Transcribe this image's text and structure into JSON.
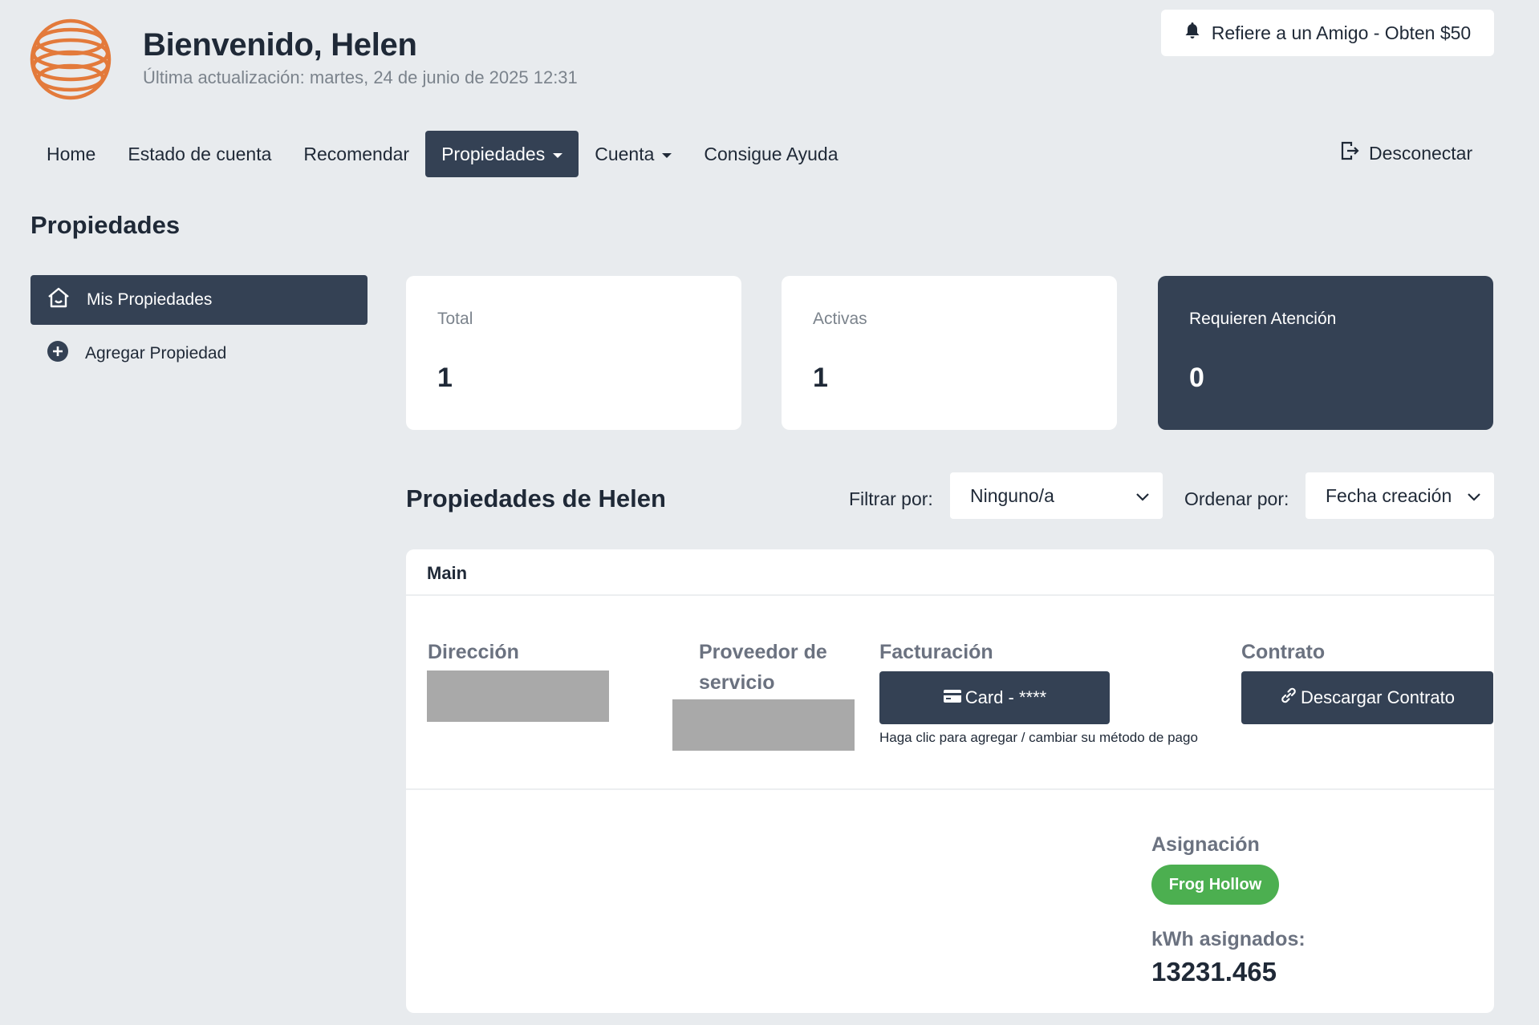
{
  "header": {
    "welcome": "Bienvenido, Helen",
    "last_updated": "Última actualización: martes, 24 de junio de 2025 12:31",
    "refer_button": "Refiere a un Amigo - Obten $50"
  },
  "nav": {
    "items": [
      {
        "label": "Home",
        "dropdown": false
      },
      {
        "label": "Estado de cuenta",
        "dropdown": false
      },
      {
        "label": "Recomendar",
        "dropdown": false
      },
      {
        "label": "Propiedades",
        "dropdown": true,
        "active": true
      },
      {
        "label": "Cuenta",
        "dropdown": true
      },
      {
        "label": "Consigue Ayuda",
        "dropdown": false
      }
    ],
    "logout": "Desconectar"
  },
  "page_title": "Propiedades",
  "sidebar": {
    "items": [
      {
        "label": "Mis Propiedades",
        "icon": "home-icon",
        "active": true
      },
      {
        "label": "Agregar Propiedad",
        "icon": "plus-circle-icon"
      }
    ]
  },
  "stats": [
    {
      "label": "Total",
      "value": "1"
    },
    {
      "label": "Activas",
      "value": "1"
    },
    {
      "label": "Requieren Atención",
      "value": "0"
    }
  ],
  "properties": {
    "title": "Propiedades de Helen",
    "filter_label": "Filtrar por:",
    "filter_value": "Ninguno/a",
    "sort_label": "Ordenar por:",
    "sort_value": "Fecha creación"
  },
  "property_card": {
    "name": "Main",
    "address_label": "Dirección",
    "provider_label": "Proveedor de servicio",
    "billing_label": "Facturación",
    "billing_button": "Card - ****",
    "billing_hint": "Haga clic para agregar / cambiar su método de pago",
    "contract_label": "Contrato",
    "contract_button": "Descargar Contrato",
    "assignment_label": "Asignación",
    "assignment_value": "Frog Hollow",
    "kwh_label": "kWh asignados:",
    "kwh_value": "13231.465"
  },
  "colors": {
    "background": "#e8ebee",
    "dark": "#344154",
    "accent": "#e37a3b",
    "success": "#4caf50"
  }
}
